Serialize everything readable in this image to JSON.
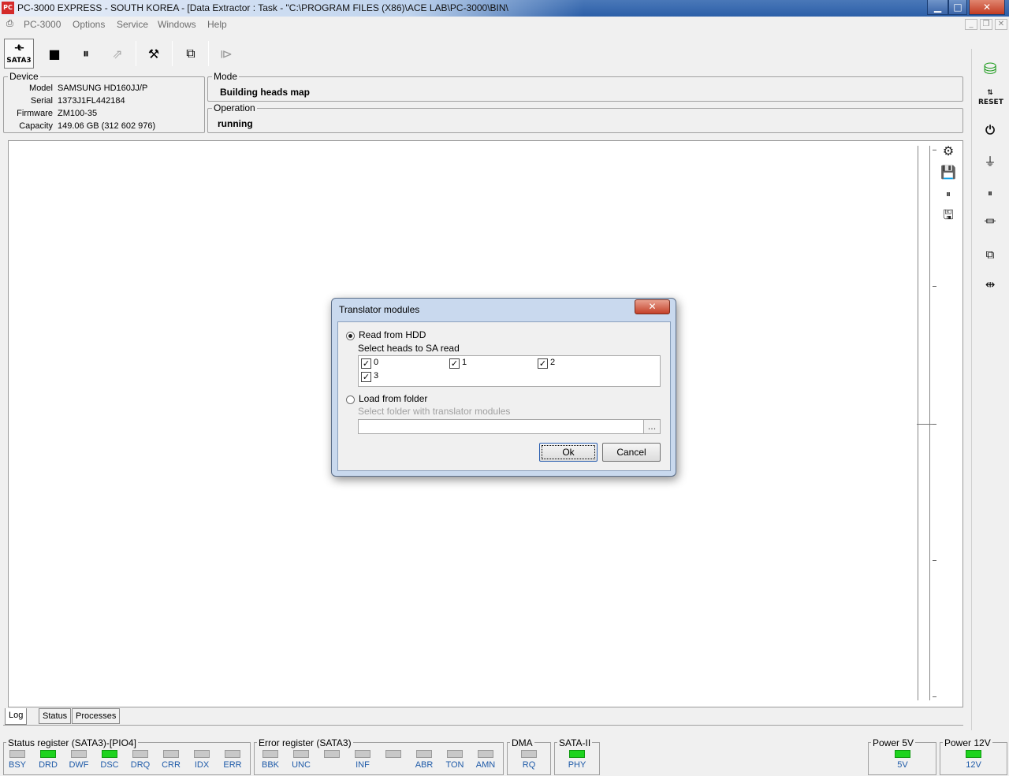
{
  "window": {
    "title": "PC-3000 EXPRESS - SOUTH KOREA - [Data Extractor : Task - \"C:\\PROGRAM FILES (X86)\\ACE LAB\\PC-3000\\BIN\\",
    "app_icon": "pc3000-app-icon",
    "min": "▁",
    "max": "□",
    "close": "✕"
  },
  "menu": {
    "items": [
      "PC-3000",
      "Options",
      "Service",
      "Windows",
      "Help"
    ],
    "mdi_min": "_",
    "mdi_restore": "❐",
    "mdi_close": "✕"
  },
  "toolbar": {
    "sata_label": "SATA3",
    "sata_icon": "-ŧ-",
    "stop": "■",
    "pause": "⏸",
    "export": "⇗",
    "tools": "⚒",
    "copy": "⧉",
    "run": "⧐"
  },
  "device": {
    "legend": "Device",
    "fields": [
      {
        "k": "Model",
        "v": "SAMSUNG HD160JJ/P"
      },
      {
        "k": "Serial",
        "v": "1373J1FL442184"
      },
      {
        "k": "Firmware",
        "v": "ZM100-35"
      },
      {
        "k": "Capacity",
        "v": "149.06 GB (312 602 976)"
      }
    ]
  },
  "mode": {
    "legend": "Mode",
    "value": "Building heads map"
  },
  "operation": {
    "legend": "Operation",
    "value": "running"
  },
  "tabs": [
    "Log",
    "Status",
    "Processes"
  ],
  "dialog": {
    "title": "Translator modules",
    "close": "✕",
    "read_from_hdd": "Read from HDD",
    "select_heads": "Select heads to SA read",
    "heads": [
      {
        "label": "0",
        "checked": true
      },
      {
        "label": "1",
        "checked": true
      },
      {
        "label": "2",
        "checked": true
      },
      {
        "label": "3",
        "checked": true
      }
    ],
    "check_mark": "✓",
    "load_from_folder": "Load from folder",
    "select_folder": "Select folder with translator modules",
    "folder_value": "",
    "browse": "...",
    "ok": "Ok",
    "cancel": "Cancel"
  },
  "registers": {
    "status": {
      "legend": "Status register (SATA3)-[PIO4]",
      "leds": [
        {
          "label": "BSY",
          "on": false
        },
        {
          "label": "DRD",
          "on": true
        },
        {
          "label": "DWF",
          "on": false
        },
        {
          "label": "DSC",
          "on": true
        },
        {
          "label": "DRQ",
          "on": false
        },
        {
          "label": "CRR",
          "on": false
        },
        {
          "label": "IDX",
          "on": false
        },
        {
          "label": "ERR",
          "on": false
        }
      ]
    },
    "error": {
      "legend": "Error register (SATA3)",
      "leds": [
        {
          "label": "BBK",
          "on": false
        },
        {
          "label": "UNC",
          "on": false
        },
        {
          "label": "",
          "on": false
        },
        {
          "label": "INF",
          "on": false
        },
        {
          "label": "",
          "on": false
        },
        {
          "label": "ABR",
          "on": false
        },
        {
          "label": "TON",
          "on": false
        },
        {
          "label": "AMN",
          "on": false
        }
      ]
    },
    "dma": {
      "legend": "DMA",
      "label": "RQ",
      "on": false
    },
    "sata": {
      "legend": "SATA-II",
      "label": "PHY",
      "on": true
    },
    "p5": {
      "legend": "Power 5V",
      "label": "5V",
      "on": true
    },
    "p12": {
      "legend": "Power 12V",
      "label": "12V",
      "on": true
    }
  },
  "colors": {
    "led_on": "#1ed31e",
    "led_off": "#c8c8c8",
    "label_blue": "#1e5aa8"
  }
}
